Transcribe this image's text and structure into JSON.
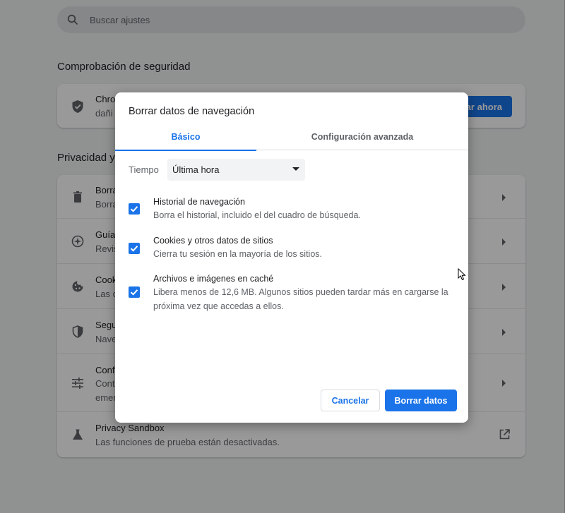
{
  "search": {
    "placeholder": "Buscar ajustes"
  },
  "safety_check": {
    "section_title": "Comprobación de seguridad",
    "line1": "Chro",
    "line2": "dañi",
    "button_label": "obar ahora"
  },
  "privacy": {
    "section_title": "Privacidad y s",
    "rows": [
      {
        "icon": "trash-icon",
        "title": "Borra",
        "subtitle": "Borra"
      },
      {
        "icon": "compass-icon",
        "title": "Guía",
        "subtitle": "Revis"
      },
      {
        "icon": "cookie-icon",
        "title": "Cook",
        "subtitle": "Las c"
      },
      {
        "icon": "shield-icon",
        "title": "Segu",
        "subtitle": "Nave"
      },
      {
        "icon": "tune-icon",
        "title": "Conf",
        "subtitle": "Cont",
        "subtitle2": "emer"
      },
      {
        "icon": "flask-icon",
        "title": "Privacy Sandbox",
        "subtitle": "Las funciones de prueba están desactivadas."
      }
    ]
  },
  "dialog": {
    "title": "Borrar datos de navegación",
    "tabs": [
      {
        "label": "Básico",
        "active": true
      },
      {
        "label": "Configuración avanzada",
        "active": false
      }
    ],
    "time_range": {
      "label": "Tiempo",
      "selected": "Última hora"
    },
    "options": [
      {
        "title": "Historial de navegación",
        "description": "Borra el historial, incluido el del cuadro de búsqueda.",
        "checked": true
      },
      {
        "title": "Cookies y otros datos de sitios",
        "description": "Cierra tu sesión en la mayoría de los sitios.",
        "checked": true
      },
      {
        "title": "Archivos e imágenes en caché",
        "description": "Libera menos de 12,6 MB. Algunos sitios pueden tardar más en cargarse la próxima vez que accedas a ellos.",
        "checked": true
      }
    ],
    "cancel_label": "Cancelar",
    "confirm_label": "Borrar datos"
  },
  "colors": {
    "accent": "#1a73e8",
    "text": "#202124",
    "secondary_text": "#5f6368"
  }
}
